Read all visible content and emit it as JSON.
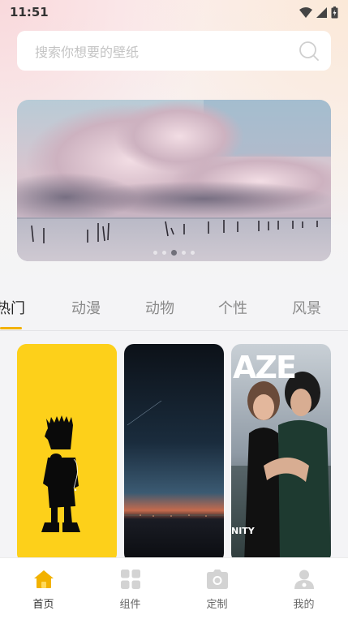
{
  "status_bar": {
    "time": "11:51"
  },
  "search": {
    "placeholder": "搜索你想要的壁纸"
  },
  "banner": {
    "dots_total": 5,
    "active_dot": 3
  },
  "tabs": [
    {
      "label": "热门",
      "active": true
    },
    {
      "label": "动漫",
      "active": false
    },
    {
      "label": "动物",
      "active": false
    },
    {
      "label": "个性",
      "active": false
    },
    {
      "label": "风景",
      "active": false
    }
  ],
  "cards": [
    {
      "theme": "yellow silhouette",
      "accent": "#FDD01A"
    },
    {
      "theme": "night sunset",
      "accent": "#0d1620"
    },
    {
      "theme": "magazine cover",
      "caption": "NITY",
      "cover_text": "AZE"
    }
  ],
  "bottom_nav": [
    {
      "label": "首页",
      "icon": "home-icon",
      "active": true
    },
    {
      "label": "组件",
      "icon": "grid-icon",
      "active": false
    },
    {
      "label": "定制",
      "icon": "camera-icon",
      "active": false
    },
    {
      "label": "我的",
      "icon": "user-icon",
      "active": false
    }
  ],
  "colors": {
    "accent": "#F2B200",
    "tab_active": "#222222",
    "tab_inactive": "#8A8A8A"
  }
}
